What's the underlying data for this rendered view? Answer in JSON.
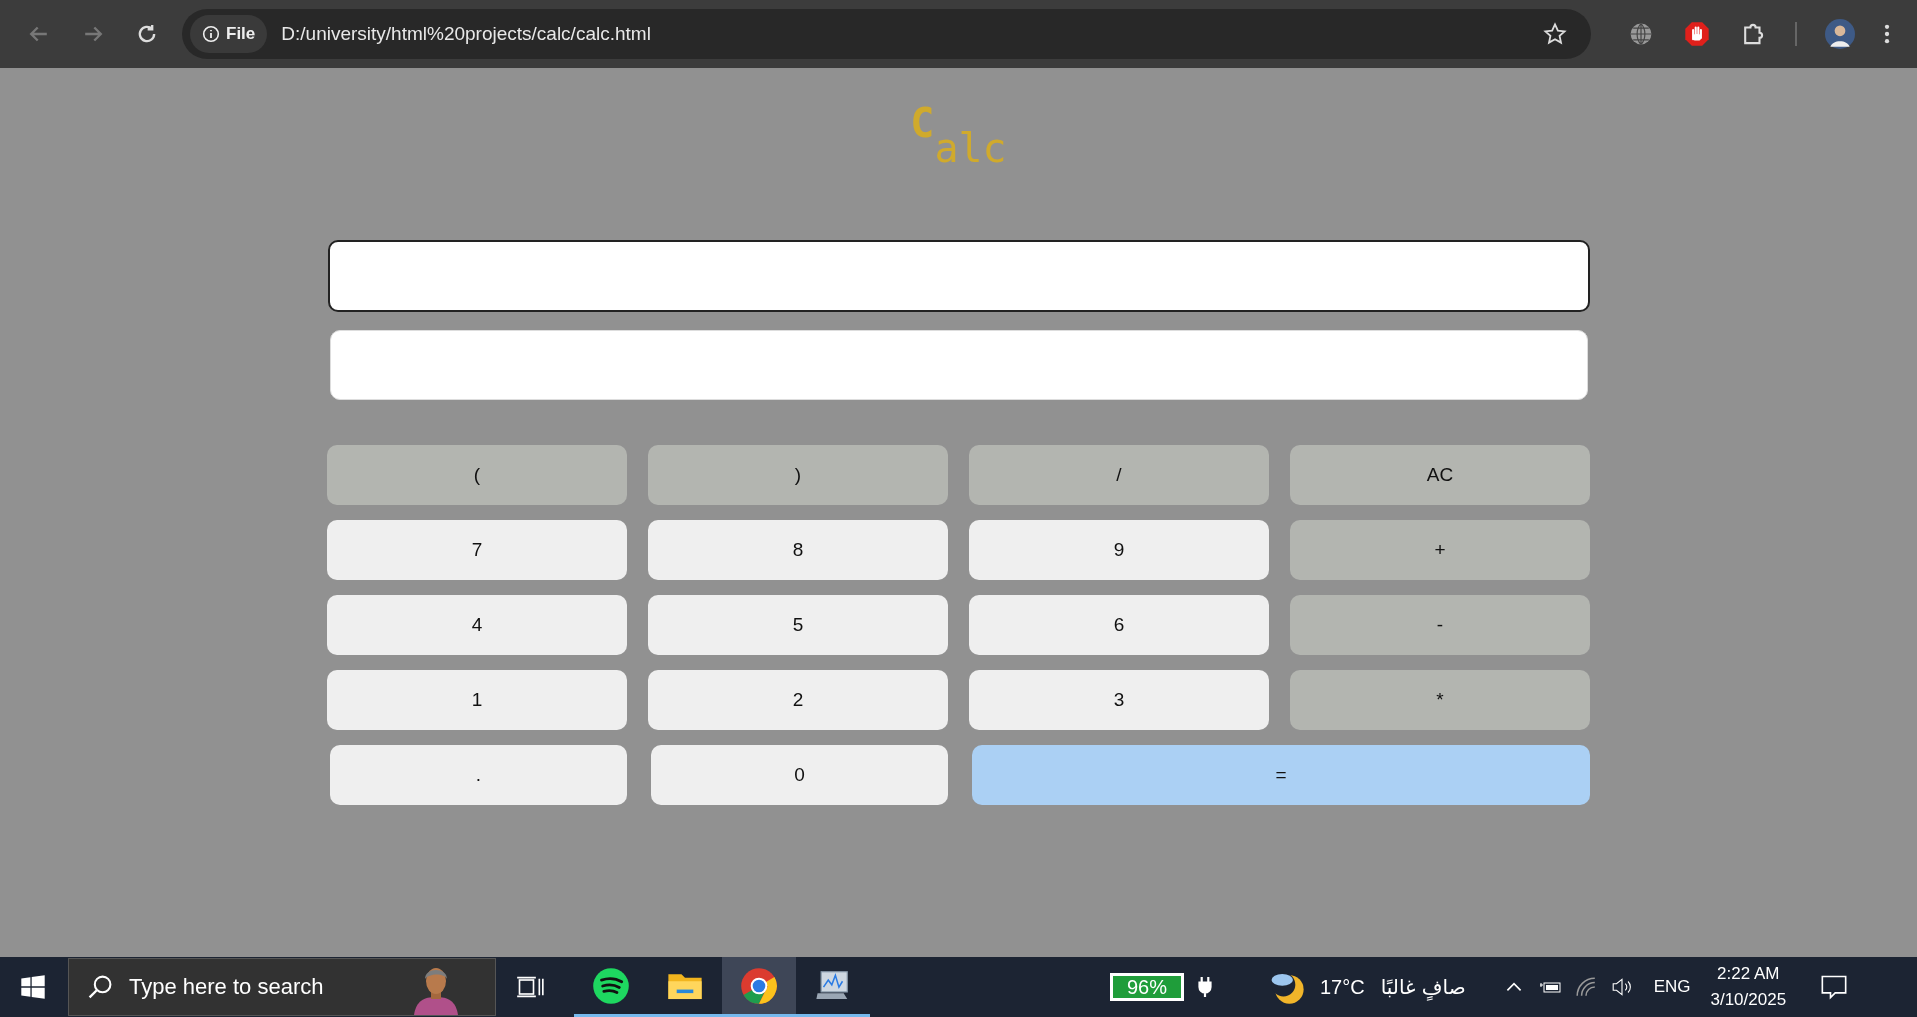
{
  "browser": {
    "site_chip": "File",
    "url": "D:/university/html%20projects/calc/calc.html"
  },
  "title": {
    "initial": "C",
    "rest": "alc"
  },
  "display": {
    "input_focused": true
  },
  "buttons": [
    {
      "label": "(",
      "kind": "op"
    },
    {
      "label": ")",
      "kind": "op"
    },
    {
      "label": "/",
      "kind": "op"
    },
    {
      "label": "AC",
      "kind": "op"
    },
    {
      "label": "7",
      "kind": "num"
    },
    {
      "label": "8",
      "kind": "num"
    },
    {
      "label": "9",
      "kind": "num"
    },
    {
      "label": "+",
      "kind": "op"
    },
    {
      "label": "4",
      "kind": "num"
    },
    {
      "label": "5",
      "kind": "num"
    },
    {
      "label": "6",
      "kind": "num"
    },
    {
      "label": "-",
      "kind": "op"
    },
    {
      "label": "1",
      "kind": "num"
    },
    {
      "label": "2",
      "kind": "num"
    },
    {
      "label": "3",
      "kind": "num"
    },
    {
      "label": "*",
      "kind": "op"
    },
    {
      "label": ".",
      "kind": "num"
    },
    {
      "label": "0",
      "kind": "num"
    },
    {
      "label": "=",
      "kind": "equals"
    }
  ],
  "taskbar": {
    "search_placeholder": "Type here to search",
    "apps": [
      {
        "kind": "spotify",
        "selected": false
      },
      {
        "kind": "explorer",
        "selected": false
      },
      {
        "kind": "chrome",
        "selected": true
      },
      {
        "kind": "monitor",
        "selected": false
      }
    ],
    "battery": "96%",
    "weather_temp": "17°C",
    "weather_text": "صافٍ غالبًا",
    "language": "ENG",
    "time": "2:22 AM",
    "date": "3/10/2025"
  }
}
